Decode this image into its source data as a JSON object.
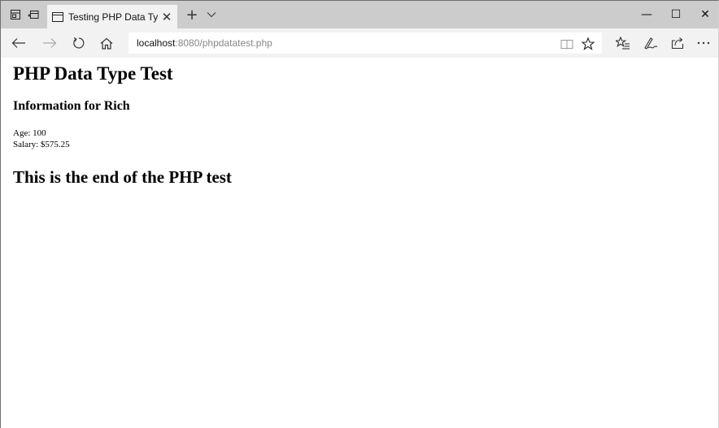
{
  "browser": {
    "tab": {
      "title": "Testing PHP Data Types",
      "close_glyph": "✕",
      "icon": "page-icon"
    },
    "new_tab_glyph": "+",
    "tab_menu_glyph": "⌵",
    "window_controls": {
      "minimize": "—",
      "maximize": "☐",
      "close": "✕"
    },
    "address": {
      "host": "localhost",
      "path": ":8080/phpdatatest.php"
    },
    "icons": [
      "set-aside-tabs-icon",
      "restore-tabs-icon",
      "back-icon",
      "forward-icon",
      "refresh-icon",
      "home-icon",
      "reading-view-icon",
      "favorite-star-icon",
      "favorites-hub-icon",
      "web-note-icon",
      "share-icon",
      "more-icon"
    ]
  },
  "page": {
    "heading": "PHP Data Type Test",
    "subheading": "Information for Rich",
    "age_line": "Age: 100",
    "salary_line": "Salary: $575.25",
    "footer_heading": "This is the end of the PHP test"
  }
}
